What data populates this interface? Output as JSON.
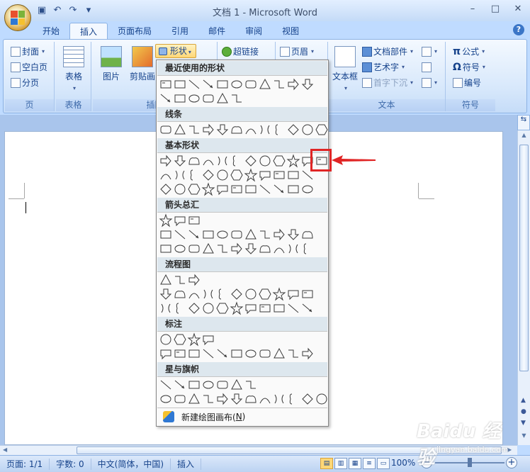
{
  "window": {
    "title": "文档 1 - Microsoft Word",
    "controls": [
      "–",
      "□",
      "✕"
    ]
  },
  "qat": {
    "items": [
      "save-icon",
      "undo-icon",
      "redo-icon",
      "customize-icon"
    ],
    "glyphs": [
      "▣",
      "↶",
      "↷",
      "▾"
    ]
  },
  "tabs": [
    "开始",
    "插入",
    "页面布局",
    "引用",
    "邮件",
    "审阅",
    "视图"
  ],
  "ribbon": {
    "pages": {
      "label": "页",
      "items": [
        "封面",
        "空白页",
        "分页"
      ]
    },
    "tables": {
      "label": "表格",
      "button": "表格"
    },
    "illustrations": {
      "label": "插图",
      "picture": "图片",
      "clipart": "剪贴画",
      "shapes": "形状"
    },
    "links": {
      "hyperlink": "超链接"
    },
    "header_footer": {
      "header": "页眉"
    },
    "text": {
      "label": "文本",
      "textbox": "文本框",
      "parts": "文档部件",
      "wordart": "艺术字",
      "dropcap": "首字下沉"
    },
    "symbols": {
      "label": "符号",
      "equation": "公式",
      "symbol": "符号",
      "number": "编号"
    },
    "equation_glyph": "π",
    "symbol_glyph": "Ω",
    "help_glyph": "?"
  },
  "dropdown": {
    "sections": [
      {
        "title": "最近使用的形状"
      },
      {
        "title": "线条"
      },
      {
        "title": "基本形状"
      },
      {
        "title": "箭头总汇"
      },
      {
        "title": "流程图"
      },
      {
        "title": "标注"
      },
      {
        "title": "星与旗帜"
      }
    ],
    "footer_text": "新建绘图画布(",
    "footer_key": "N",
    "footer_close": ")"
  },
  "statusbar": {
    "page": "页面: 1/1",
    "words": "字数: 0",
    "language": "中文(简体，中国)",
    "mode": "插入",
    "zoom": "100%",
    "zoom_level": 1.0
  },
  "ruler_glyph": "⇆",
  "watermark": {
    "line1": "Baidu 经验",
    "line2": "jingyan.baidu.com"
  },
  "colors": {
    "accent": "#15428b",
    "highlight": "#e02525",
    "ribbon": "#d6e7fb"
  }
}
